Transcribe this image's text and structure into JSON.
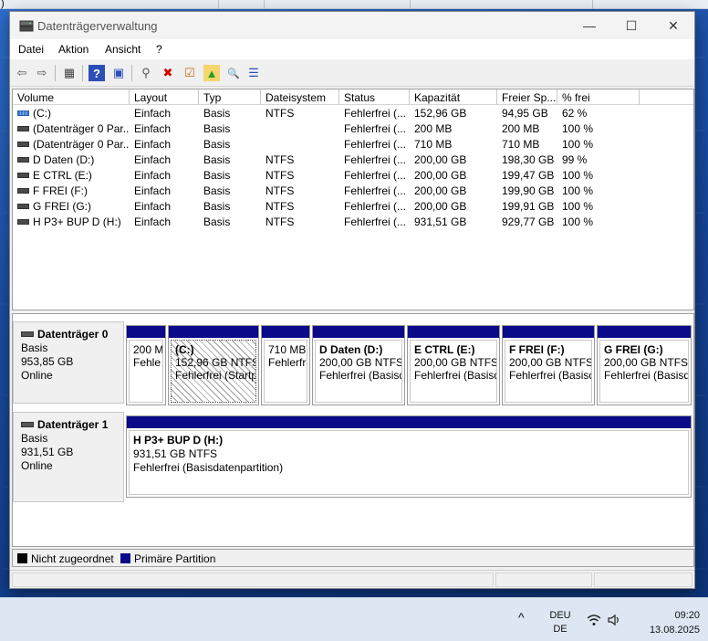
{
  "window": {
    "title": "Datenträgerverwaltung",
    "controls": {
      "minimize": "—",
      "maximize": "☐",
      "close": "✕"
    }
  },
  "background": {
    "left_glyph": ")"
  },
  "menu": [
    "Datei",
    "Aktion",
    "Ansicht",
    "?"
  ],
  "toolbar": [
    {
      "icon": "back-arrow-icon",
      "glyph": "⇦"
    },
    {
      "icon": "forward-arrow-icon",
      "glyph": "⇨"
    },
    {
      "icon": "console-tree-icon",
      "glyph": "▦"
    },
    {
      "icon": "help-icon",
      "glyph": "?"
    },
    {
      "icon": "properties-icon",
      "glyph": "▣"
    },
    {
      "icon": "connect-drive-icon",
      "glyph": "⚲"
    },
    {
      "icon": "delete-icon",
      "glyph": "✖"
    },
    {
      "icon": "check-icon",
      "glyph": "☑"
    },
    {
      "icon": "open-icon",
      "glyph": "▲"
    },
    {
      "icon": "explore-icon",
      "glyph": "🔍"
    },
    {
      "icon": "settings-list-icon",
      "glyph": "☰"
    }
  ],
  "volumes": {
    "columns": [
      "Volume",
      "Layout",
      "Typ",
      "Dateisystem",
      "Status",
      "Kapazität",
      "Freier Sp...",
      "% frei"
    ],
    "rows": [
      {
        "volume": "(C:)",
        "layout": "Einfach",
        "typ": "Basis",
        "fs": "NTFS",
        "status": "Fehlerfrei (...",
        "cap": "152,96 GB",
        "free": "94,95 GB",
        "pct": "62 %",
        "icon": "system-drive-icon"
      },
      {
        "volume": "(Datenträger 0 Par...",
        "layout": "Einfach",
        "typ": "Basis",
        "fs": "",
        "status": "Fehlerfrei (...",
        "cap": "200 MB",
        "free": "200 MB",
        "pct": "100 %",
        "icon": "drive-icon"
      },
      {
        "volume": "(Datenträger 0 Par...",
        "layout": "Einfach",
        "typ": "Basis",
        "fs": "",
        "status": "Fehlerfrei (...",
        "cap": "710 MB",
        "free": "710 MB",
        "pct": "100 %",
        "icon": "drive-icon"
      },
      {
        "volume": "D Daten (D:)",
        "layout": "Einfach",
        "typ": "Basis",
        "fs": "NTFS",
        "status": "Fehlerfrei (...",
        "cap": "200,00 GB",
        "free": "198,30 GB",
        "pct": "99 %",
        "icon": "drive-icon"
      },
      {
        "volume": "E CTRL (E:)",
        "layout": "Einfach",
        "typ": "Basis",
        "fs": "NTFS",
        "status": "Fehlerfrei (...",
        "cap": "200,00 GB",
        "free": "199,47 GB",
        "pct": "100 %",
        "icon": "drive-icon"
      },
      {
        "volume": "F FREI (F:)",
        "layout": "Einfach",
        "typ": "Basis",
        "fs": "NTFS",
        "status": "Fehlerfrei (...",
        "cap": "200,00 GB",
        "free": "199,90 GB",
        "pct": "100 %",
        "icon": "drive-icon"
      },
      {
        "volume": "G FREI (G:)",
        "layout": "Einfach",
        "typ": "Basis",
        "fs": "NTFS",
        "status": "Fehlerfrei (...",
        "cap": "200,00 GB",
        "free": "199,91 GB",
        "pct": "100 %",
        "icon": "drive-icon"
      },
      {
        "volume": "H P3+ BUP D (H:)",
        "layout": "Einfach",
        "typ": "Basis",
        "fs": "NTFS",
        "status": "Fehlerfrei (...",
        "cap": "931,51 GB",
        "free": "929,77 GB",
        "pct": "100 %",
        "icon": "drive-icon"
      }
    ]
  },
  "disks": [
    {
      "name": "Datenträger 0",
      "type": "Basis",
      "size": "953,85 GB",
      "state": "Online",
      "partitions": [
        {
          "name": "",
          "size": "200 M",
          "status": "Fehle",
          "hatched": false
        },
        {
          "name": "(C:)",
          "size": "152,96 GB NTFS",
          "status": "Fehlerfrei (Startp",
          "hatched": true
        },
        {
          "name": "",
          "size": "710 MB",
          "status": "Fehlerfr",
          "hatched": false
        },
        {
          "name": "D Daten  (D:)",
          "size": "200,00 GB NTFS",
          "status": "Fehlerfrei (Basisd",
          "hatched": false
        },
        {
          "name": "E CTRL  (E:)",
          "size": "200,00 GB NTFS",
          "status": "Fehlerfrei (Basisd",
          "hatched": false
        },
        {
          "name": "F FREI  (F:)",
          "size": "200,00 GB NTFS",
          "status": "Fehlerfrei (Basisd",
          "hatched": false
        },
        {
          "name": "G FREI  (G:)",
          "size": "200,00 GB NTFS",
          "status": "Fehlerfrei (Basisda",
          "hatched": false
        }
      ]
    },
    {
      "name": "Datenträger 1",
      "type": "Basis",
      "size": "931,51 GB",
      "state": "Online",
      "partitions": [
        {
          "name": "H P3+ BUP D  (H:)",
          "size": "931,51 GB NTFS",
          "status": "Fehlerfrei (Basisdatenpartition)",
          "hatched": false
        }
      ]
    }
  ],
  "legend": [
    {
      "label": "Nicht zugeordnet",
      "color": "#000000"
    },
    {
      "label": "Primäre Partition",
      "color": "#0b0b8a"
    }
  ],
  "taskbar": {
    "chevron": "^",
    "lang_top": "DEU",
    "lang_bottom": "DE",
    "time": "09:20",
    "date": "13.08.2025"
  }
}
